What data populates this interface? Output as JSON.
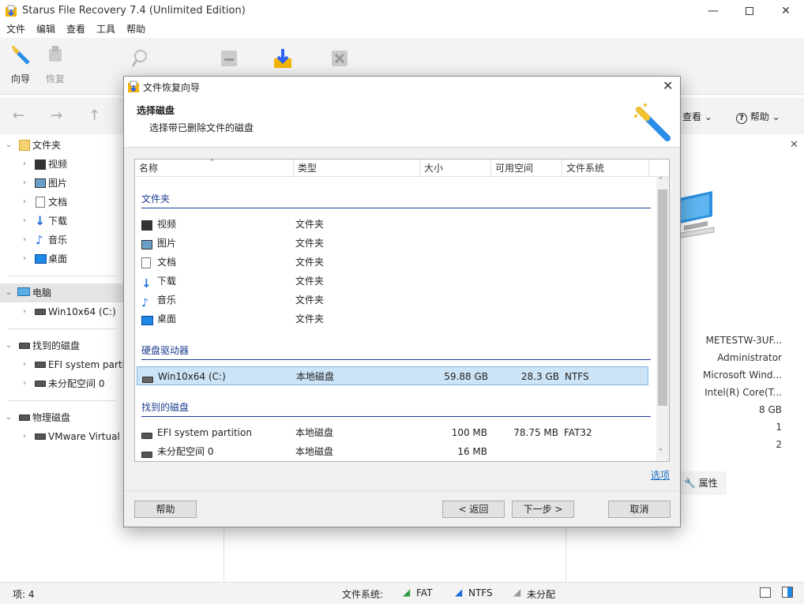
{
  "app": {
    "title": "Starus File Recovery 7.4 (Unlimited Edition)"
  },
  "menu": [
    "文件",
    "编辑",
    "查看",
    "工具",
    "帮助"
  ],
  "ribbon": {
    "wizard": "向导",
    "recover": "恢复",
    "view": "查看",
    "help": "帮助"
  },
  "tree": {
    "folders": "文件夹",
    "folder_items": [
      "视频",
      "图片",
      "文档",
      "下载",
      "音乐",
      "桌面"
    ],
    "computer": "电脑",
    "computer_items": [
      "Win10x64 (C:)"
    ],
    "found": "找到的磁盘",
    "found_items": [
      "EFI system partit",
      "未分配空间 0"
    ],
    "physical": "物理磁盘",
    "physical_items": [
      "VMware Virtual N"
    ]
  },
  "info": {
    "values": [
      "METESTW-3UF...",
      "Administrator",
      "Microsoft Wind...",
      "Intel(R) Core(T...",
      "8 GB",
      "1",
      "2"
    ],
    "props_label": "属性"
  },
  "status": {
    "items": "项: 4",
    "fs_label": "文件系统:",
    "fat": "FAT",
    "ntfs": "NTFS",
    "unalloc": "未分配"
  },
  "dialog": {
    "title": "文件恢复向导",
    "heading": "选择磁盘",
    "subheading": "选择带已删除文件的磁盘",
    "columns": [
      "名称",
      "类型",
      "大小",
      "可用空间",
      "文件系统"
    ],
    "groups": {
      "folders": "文件夹",
      "drives": "硬盘驱动器",
      "found": "找到的磁盘"
    },
    "folder_rows": [
      {
        "name": "视频",
        "type": "文件夹"
      },
      {
        "name": "图片",
        "type": "文件夹"
      },
      {
        "name": "文档",
        "type": "文件夹"
      },
      {
        "name": "下载",
        "type": "文件夹"
      },
      {
        "name": "音乐",
        "type": "文件夹"
      },
      {
        "name": "桌面",
        "type": "文件夹"
      }
    ],
    "drive_rows": [
      {
        "name": "Win10x64 (C:)",
        "type": "本地磁盘",
        "size": "59.88 GB",
        "free": "28.3 GB",
        "fs": "NTFS"
      }
    ],
    "found_rows": [
      {
        "name": "EFI system partition",
        "type": "本地磁盘",
        "size": "100 MB",
        "free": "78.75 MB",
        "fs": "FAT32"
      },
      {
        "name": "未分配空间 0",
        "type": "本地磁盘",
        "size": "16 MB",
        "free": "",
        "fs": ""
      }
    ],
    "options_link": "选项",
    "buttons": {
      "help": "帮助",
      "back": "< 返回",
      "next": "下一步 >",
      "cancel": "取消"
    }
  },
  "colors": {
    "accent": "#1a3b8f",
    "selection": "#cce4f7",
    "link": "#1a6fc4"
  }
}
